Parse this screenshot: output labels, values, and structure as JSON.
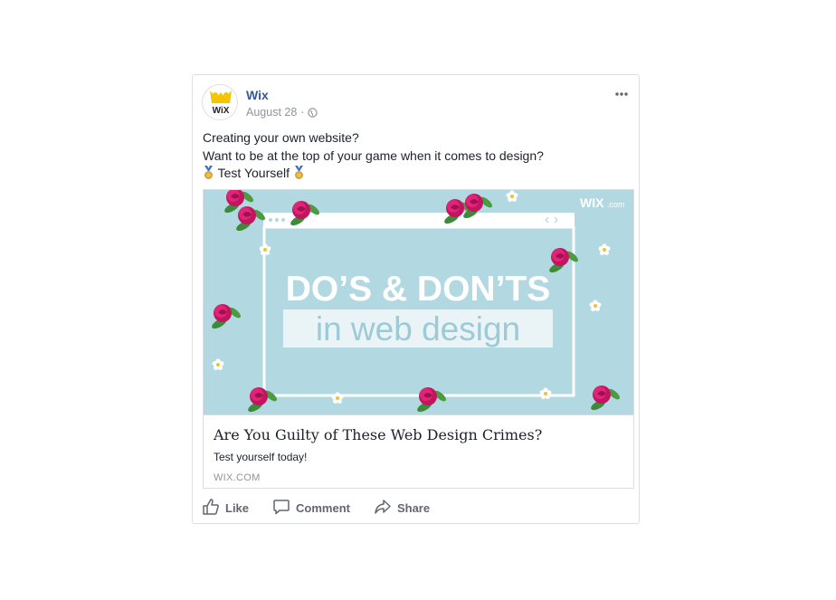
{
  "post": {
    "page_name": "Wix",
    "date": "August 28",
    "separator": "·",
    "avatar_logo": "WiX",
    "more_icon": "ellipsis-icon",
    "privacy_icon": "globe-icon",
    "text_lines": [
      "Creating your own website?",
      "Want to be at the top of your game when it comes to design?"
    ],
    "cta_text": "Test Yourself",
    "medal_icon": "medal-icon"
  },
  "card": {
    "image": {
      "brand": "WIX",
      "brand_suffix": ".com",
      "headline": "DO’S & DON’TS",
      "subheadline": "in web design"
    },
    "title": "Are You Guilty of These Web Design Crimes?",
    "description": "Test yourself today!",
    "domain": "WIX.COM"
  },
  "actions": {
    "like": "Like",
    "comment": "Comment",
    "share": "Share"
  },
  "colors": {
    "page_name": "#365899",
    "muted": "#90949c",
    "hero_bg": "#b2d9e2",
    "rose": "#d81c6e",
    "leaf": "#3f8a3a"
  }
}
